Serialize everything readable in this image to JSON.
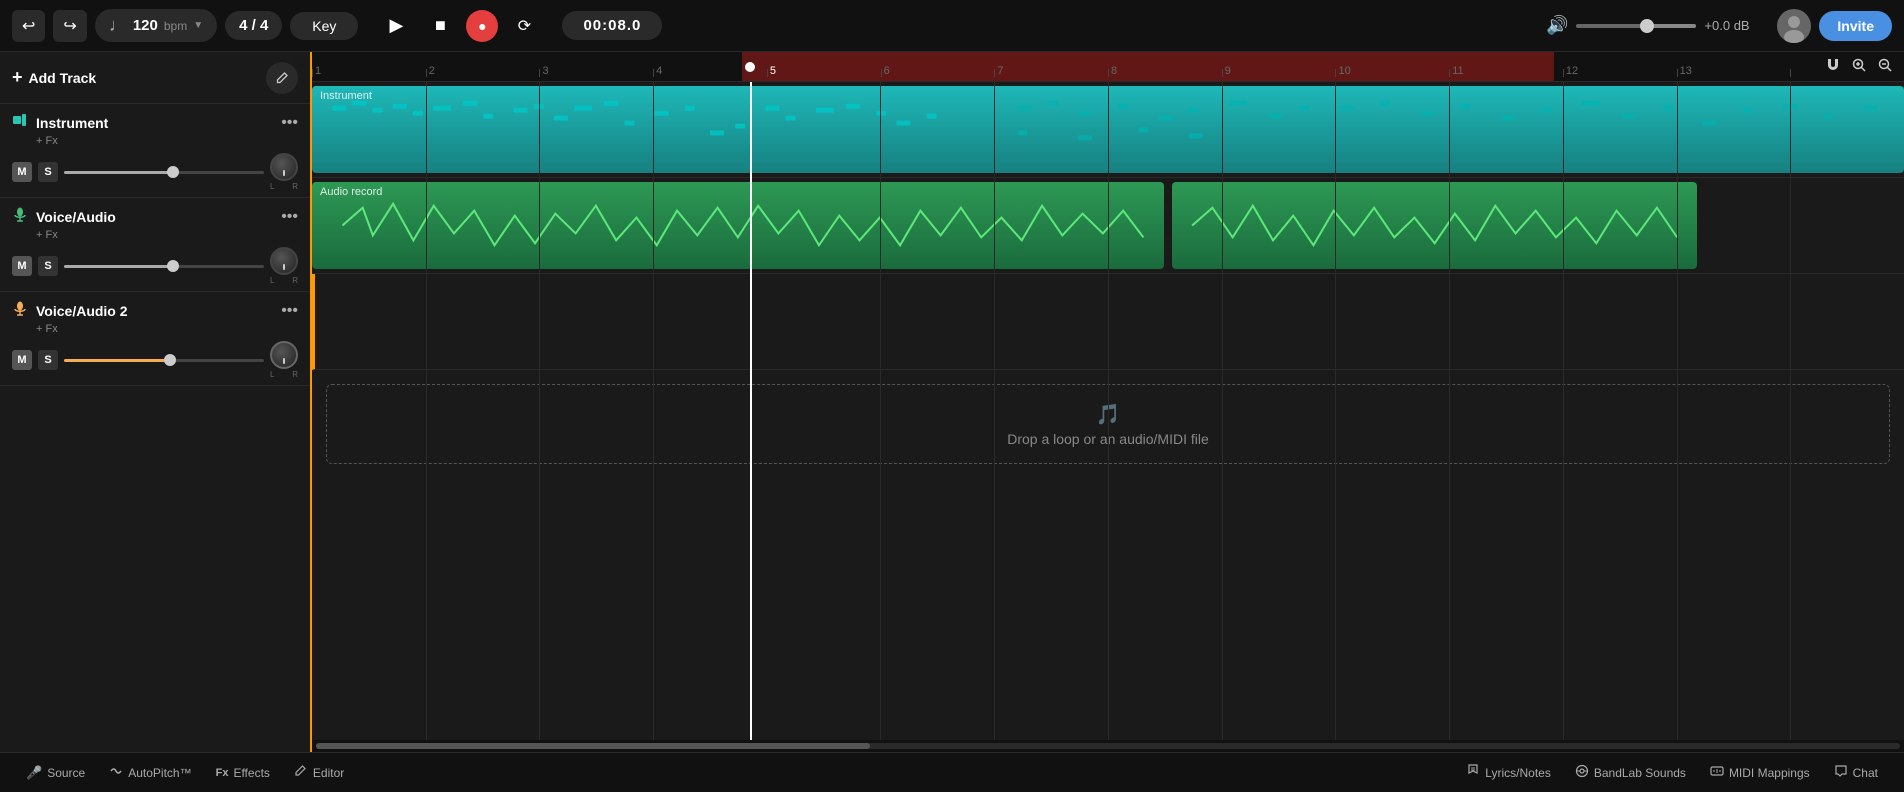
{
  "topbar": {
    "undo_label": "↩",
    "redo_label": "↪",
    "tempo": "120",
    "tempo_unit": "bpm",
    "time_sig": "4 / 4",
    "key_label": "Key",
    "play_label": "▶",
    "stop_label": "■",
    "record_label": "●",
    "loop_label": "⟳",
    "time_display": "00:08.0",
    "vol_icon": "🔊",
    "db_display": "+0.0 dB",
    "invite_label": "Invite"
  },
  "track_panel": {
    "add_track_label": "Add Track",
    "pen_icon": "✎",
    "tracks": [
      {
        "id": "instrument",
        "name": "Instrument",
        "fx": "+ Fx",
        "icon": "🎹",
        "icon_class": "teal",
        "m_label": "M",
        "s_label": "S"
      },
      {
        "id": "voice-audio",
        "name": "Voice/Audio",
        "fx": "+ Fx",
        "icon": "🎤",
        "icon_class": "green",
        "m_label": "M",
        "s_label": "S"
      },
      {
        "id": "voice-audio-2",
        "name": "Voice/Audio 2",
        "fx": "+ Fx",
        "icon": "🎤",
        "icon_class": "orange",
        "m_label": "M",
        "s_label": "S"
      }
    ]
  },
  "ruler": {
    "marks": [
      "1",
      "2",
      "3",
      "4",
      "5",
      "6",
      "7",
      "8",
      "9",
      "10",
      "11",
      "12",
      "13",
      ""
    ]
  },
  "timeline": {
    "instrument_clip_label": "Instrument",
    "audio_clip_label": "Audio record",
    "drop_zone_icon": "♪",
    "drop_zone_text": "Drop a loop or an audio/MIDI file"
  },
  "bottom_bar": {
    "tabs_left": [
      {
        "label": "Source",
        "icon": "🎤"
      },
      {
        "label": "AutoPitch™",
        "icon": "〰"
      },
      {
        "label": "Effects",
        "icon": "Fx"
      },
      {
        "label": "Editor",
        "icon": "✏"
      }
    ],
    "tabs_right": [
      {
        "label": "Lyrics/Notes",
        "icon": "♪"
      },
      {
        "label": "BandLab Sounds",
        "icon": "🎵"
      },
      {
        "label": "MIDI Mappings",
        "icon": "⊟"
      },
      {
        "label": "Chat",
        "icon": "💬"
      }
    ]
  }
}
